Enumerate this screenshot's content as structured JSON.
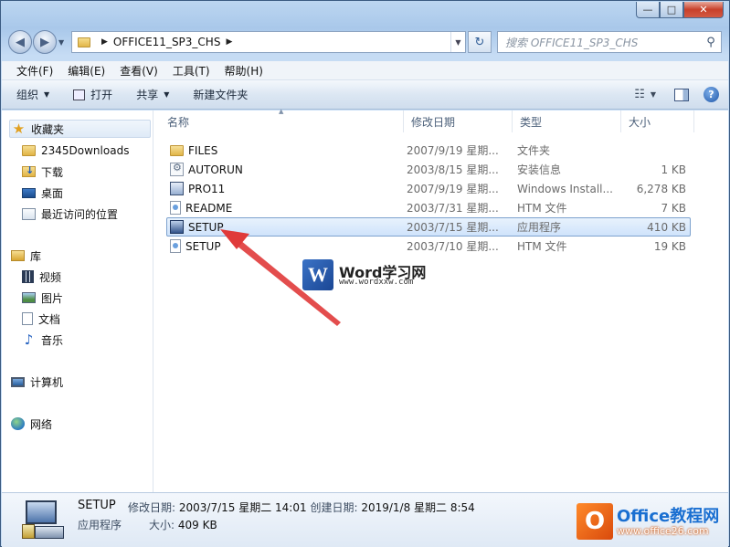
{
  "window": {
    "caption": {
      "minimize": "—",
      "maximize": "□",
      "close": "✕"
    }
  },
  "address": {
    "back": "◀",
    "forward": "▶",
    "path": [
      "OFFICE11_SP3_CHS"
    ],
    "search_placeholder": "搜索 OFFICE11_SP3_CHS"
  },
  "menu": [
    "文件(F)",
    "编辑(E)",
    "查看(V)",
    "工具(T)",
    "帮助(H)"
  ],
  "toolbar": {
    "organize": "组织",
    "open": "打开",
    "share": "共享",
    "new_folder": "新建文件夹"
  },
  "sidebar": {
    "favorites": {
      "label": "收藏夹",
      "items": [
        "2345Downloads",
        "下载",
        "桌面",
        "最近访问的位置"
      ]
    },
    "libraries": {
      "label": "库",
      "items": [
        "视频",
        "图片",
        "文档",
        "音乐"
      ]
    },
    "computer": "计算机",
    "network": "网络"
  },
  "columns": {
    "name": "名称",
    "date": "修改日期",
    "type": "类型",
    "size": "大小"
  },
  "files": [
    {
      "name": "FILES",
      "date": "2007/9/19 星期...",
      "type": "文件夹",
      "size": "",
      "icon": "folder-icon"
    },
    {
      "name": "AUTORUN",
      "date": "2003/8/15 星期...",
      "type": "安装信息",
      "size": "1 KB",
      "icon": "setup-info-icon"
    },
    {
      "name": "PRO11",
      "date": "2007/9/19 星期...",
      "type": "Windows Install...",
      "size": "6,278 KB",
      "icon": "installer-icon"
    },
    {
      "name": "README",
      "date": "2003/7/31 星期...",
      "type": "HTM 文件",
      "size": "7 KB",
      "icon": "htm-file-icon"
    },
    {
      "name": "SETUP",
      "date": "2003/7/15 星期...",
      "type": "应用程序",
      "size": "410 KB",
      "icon": "application-icon"
    },
    {
      "name": "SETUP",
      "date": "2003/7/10 星期...",
      "type": "HTM 文件",
      "size": "19 KB",
      "icon": "htm-file-icon"
    }
  ],
  "watermark": {
    "logo_letter": "W",
    "title": "Word学习网",
    "url": "www.wordxxw.com"
  },
  "details": {
    "name": "SETUP",
    "type": "应用程序",
    "modified_label": "修改日期:",
    "modified": "2003/7/15 星期二 14:01",
    "created_label": "创建日期:",
    "created": "2019/1/8 星期二 8:54",
    "size_label": "大小:",
    "size": "409 KB"
  },
  "corner_watermark": {
    "letter": "O",
    "title": "Office教程网",
    "url": "www.office26.com"
  },
  "colors": {
    "annotation_arrow": "#e03a3a",
    "selection": "#cfe3fb"
  }
}
